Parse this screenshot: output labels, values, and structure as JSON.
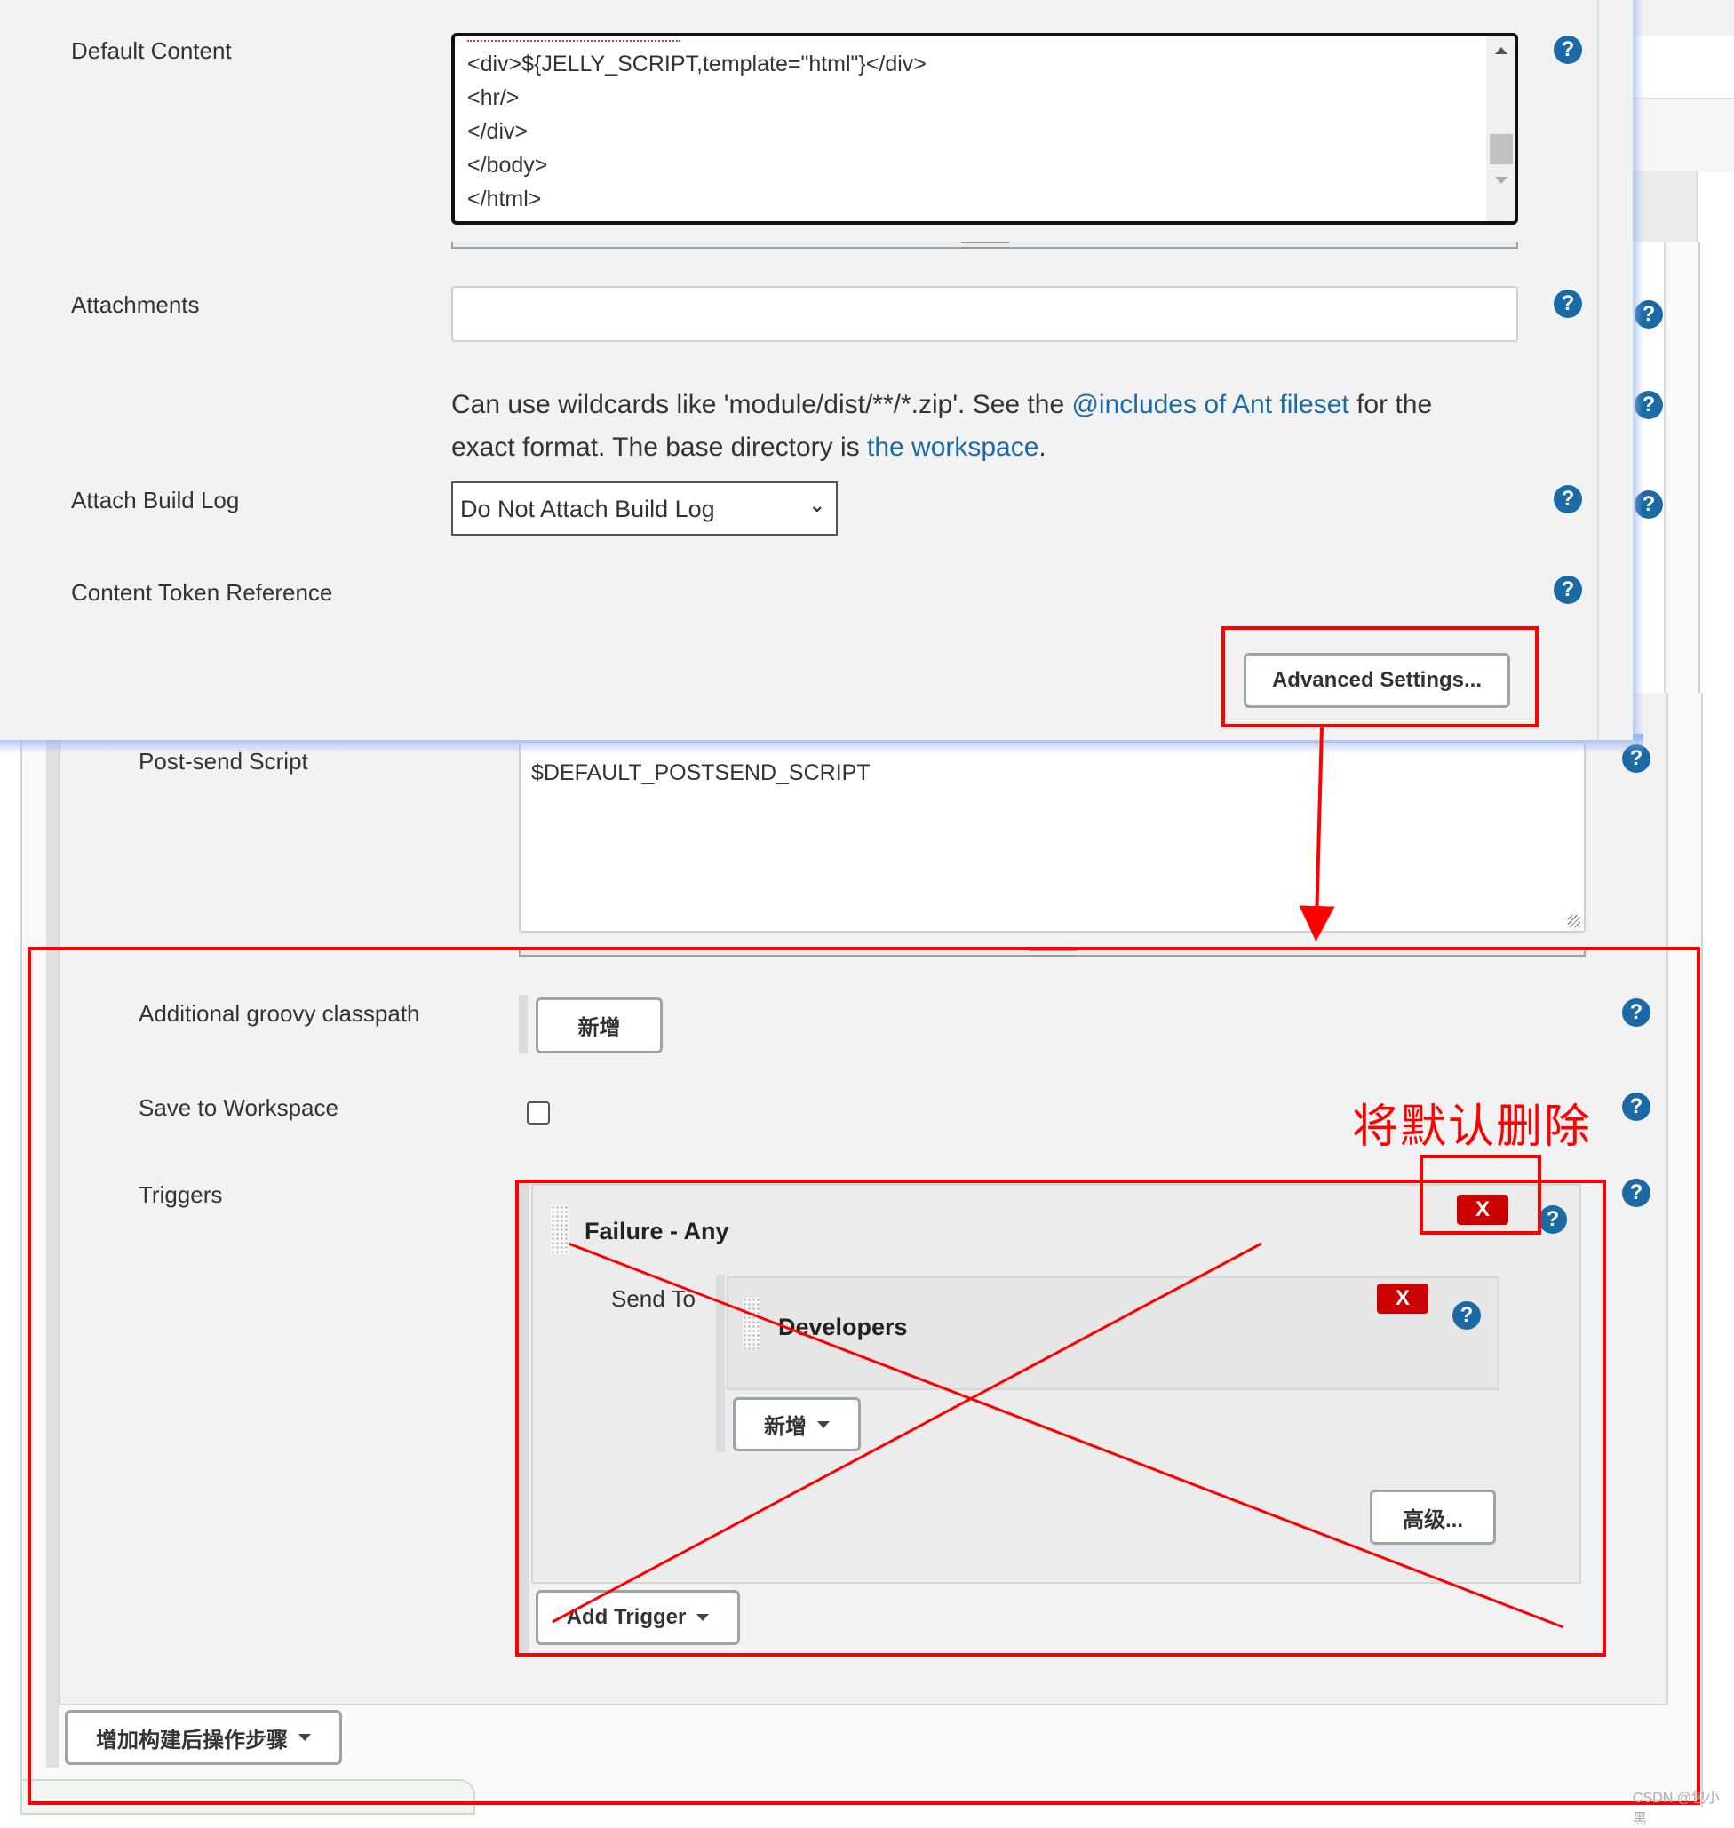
{
  "overlay": {
    "default_content": {
      "label": "Default Content",
      "lines": [
        "<div>${JELLY_SCRIPT,template=\"html\"}</div>",
        "<hr/>",
        "</div>",
        "</body>",
        "</html>"
      ],
      "help_icon": "question-circle-icon"
    },
    "attachments": {
      "label": "Attachments",
      "value": "",
      "help_part1": "Can use wildcards like 'module/dist/**/*.zip'. See the ",
      "help_link1": "@includes of Ant fileset",
      "help_part2": " for the",
      "help_part3": "exact format. The base directory is ",
      "help_link2": "the workspace",
      "help_part4": "."
    },
    "attach_build_log": {
      "label": "Attach Build Log",
      "selected": "Do Not Attach Build Log"
    },
    "content_token_reference": {
      "label": "Content Token Reference"
    },
    "advanced_settings_label": "Advanced Settings..."
  },
  "main": {
    "post_send_script": {
      "label": "Post-send Script",
      "value": "$DEFAULT_POSTSEND_SCRIPT"
    },
    "additional_groovy_classpath": {
      "label": "Additional groovy classpath",
      "add_label": "新增"
    },
    "save_to_workspace": {
      "label": "Save to Workspace",
      "checked": false
    },
    "triggers": {
      "label": "Triggers",
      "items": [
        {
          "title": "Failure - Any",
          "delete_label": "X",
          "send_to_label": "Send To",
          "recipients": [
            {
              "name": "Developers",
              "delete_label": "X"
            }
          ],
          "add_recipient_label": "新增",
          "advanced_label": "高级..."
        }
      ],
      "add_trigger_label": "Add Trigger"
    },
    "add_post_build_step_label": "增加构建后操作步骤"
  },
  "annotations": {
    "note": "将默认删除",
    "color": "#ff0000"
  },
  "watermark": "CSDN @包小黑",
  "colors": {
    "help_icon": "#1b6aa5",
    "delete_button": "#cc0000",
    "link": "#1b6aa5",
    "panel_bg": "#f2f2f2"
  }
}
